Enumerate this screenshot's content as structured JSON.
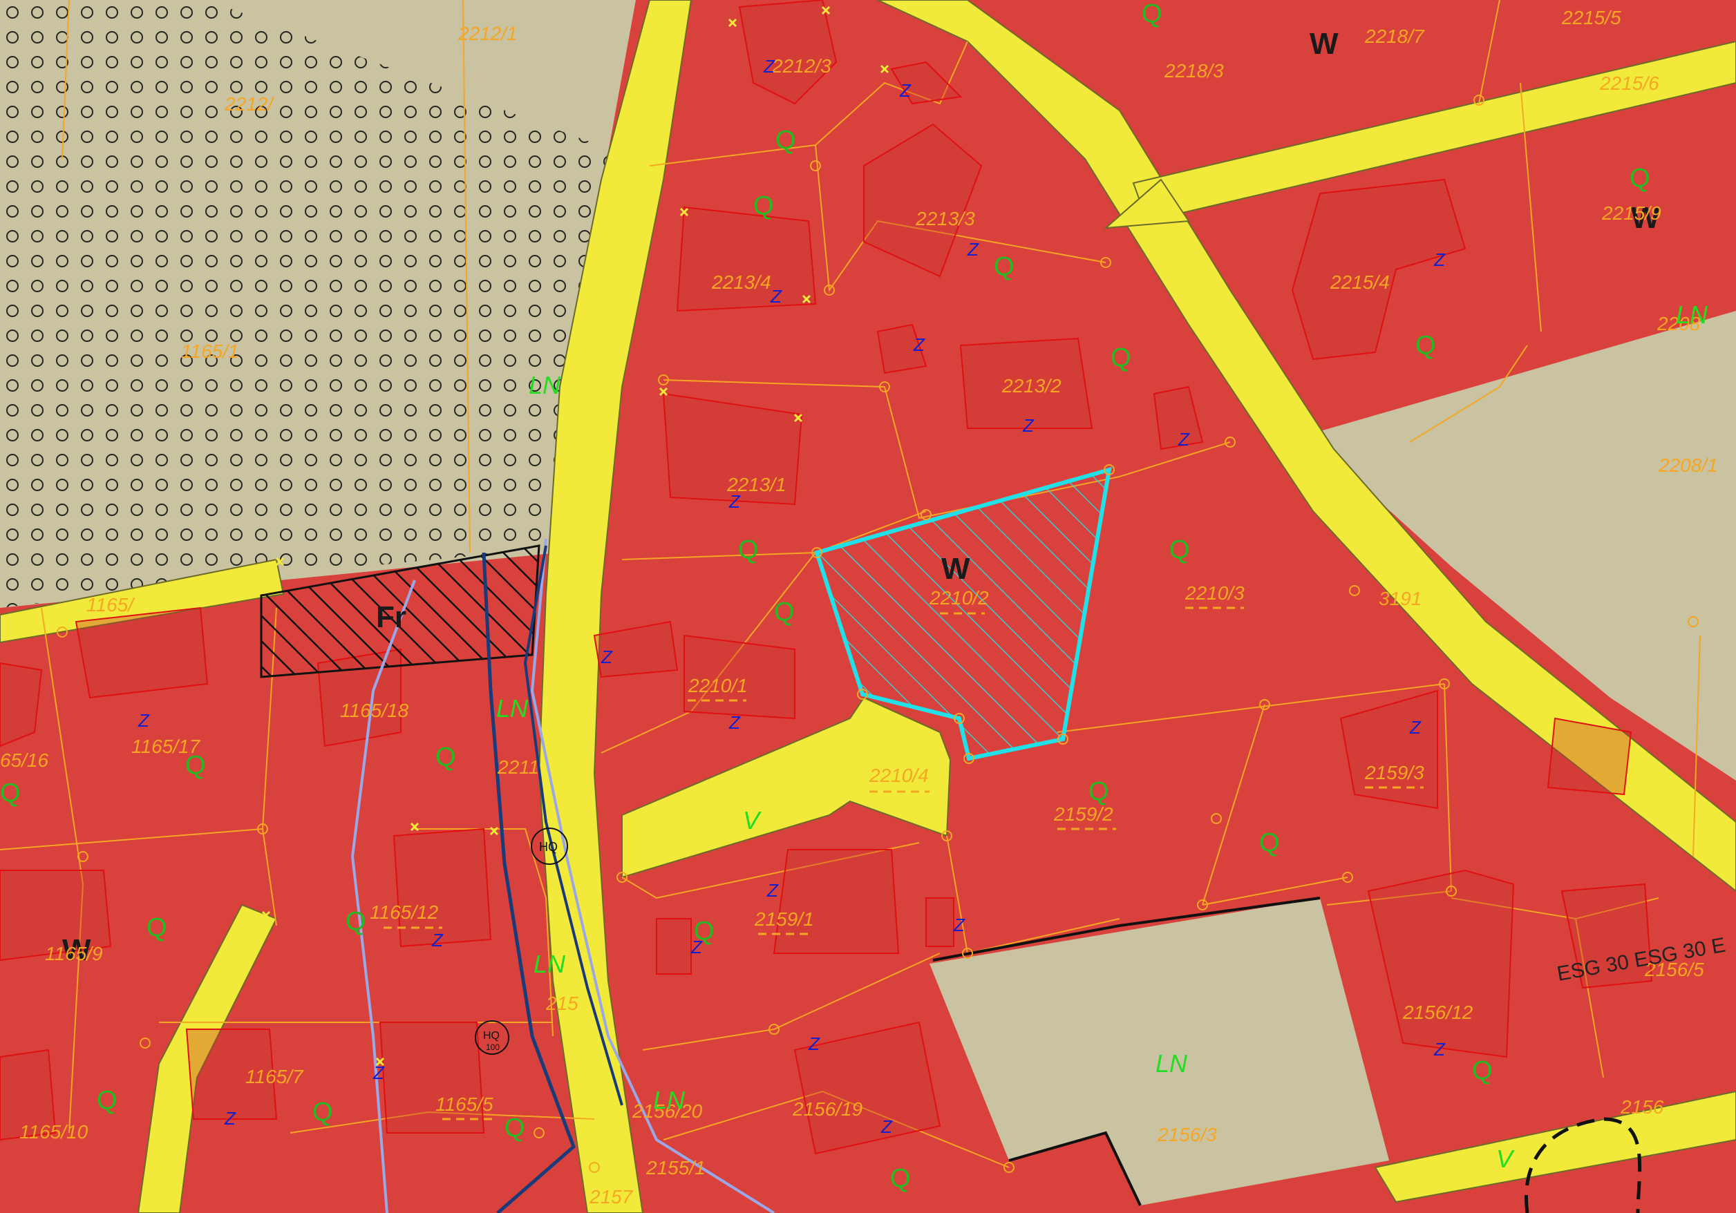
{
  "colors": {
    "residential": "#d9423c",
    "road": "#f1ea3a",
    "green_land": "#c9c3a2",
    "selection": "#22e0e8",
    "parcel_label": "#f5a623",
    "marker_q": "#22bb22",
    "marker_z": "#1020d0",
    "label_ln": "#22dd22"
  },
  "zone_labels": {
    "w_center": "W",
    "w_top": "W",
    "w_right": "W",
    "w_left": "W",
    "fr": "Fr"
  },
  "parcels": {
    "p2212_1": "2212/1",
    "p2212_3": "2212/3",
    "p2212_x": "2212/",
    "p2218_7": "2218/7",
    "p2218_3": "2218/3",
    "p2215_5": "2215/5",
    "p2215_6": "2215/6",
    "p2215_9": "2215/9",
    "p2213_3": "2213/3",
    "p2213_4": "2213/4",
    "p2213_2": "2213/2",
    "p2213_1": "2213/1",
    "p2215_4": "2215/4",
    "p2208_1": "2208/1",
    "p2208": "2208",
    "p1165_1": "1165/1",
    "p1165_x": "1165/",
    "p2210_2": "2210/2",
    "p2210_3": "2210/3",
    "p3191": "3191",
    "p2210_1": "2210/1",
    "p2210_4": "2210/4",
    "p2159_2": "2159/2",
    "p2159_3": "2159/3",
    "p1165_18": "1165/18",
    "p1165_17": "1165/17",
    "p165_16": "65/16",
    "p2211": "2211",
    "p1165_12": "1165/12",
    "p2159_1": "2159/1",
    "p1165_9": "1165/9",
    "p2156_5": "2156/5",
    "p2156_12": "2156/12",
    "p2215": "215",
    "p1165_7": "1165/7",
    "p1165_5": "1165/5",
    "p2156_20": "2156/20",
    "p2156_19": "2156/19",
    "p2156_3": "2156/3",
    "p1165_10": "1165/10",
    "p2155_1": "2155/1",
    "p2157": "2157",
    "p2156": "2156"
  },
  "markers": {
    "q": "Q",
    "z": "Z",
    "ln": "LN",
    "v": "V",
    "hq": "HQ",
    "hq100": "100"
  },
  "annotations": {
    "esg": "ESG 30 ESG 30 E"
  }
}
